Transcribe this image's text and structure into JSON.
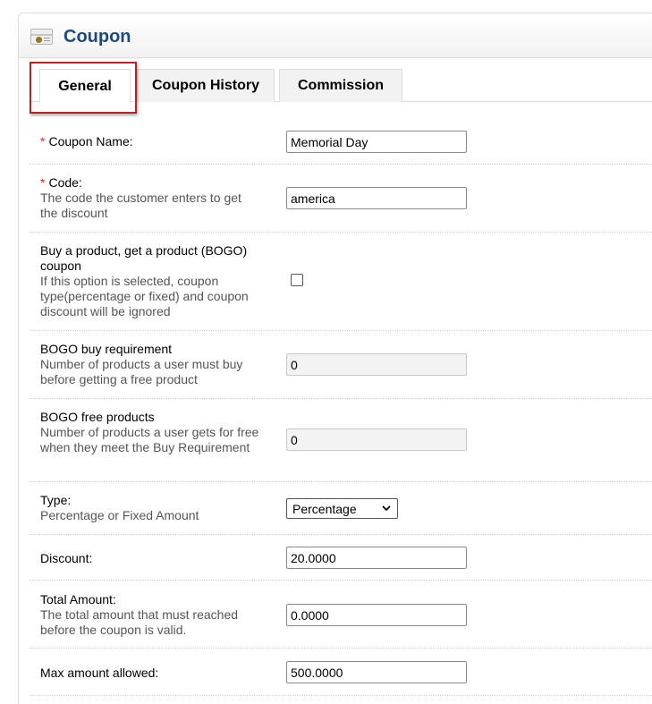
{
  "header": {
    "title": "Coupon",
    "icon": "coupon-card-icon"
  },
  "tabs": [
    {
      "label": "General",
      "active": true
    },
    {
      "label": "Coupon History",
      "active": false
    },
    {
      "label": "Commission",
      "active": false
    }
  ],
  "form": {
    "coupon_name": {
      "label": "Coupon Name:",
      "required": "*",
      "value": "Memorial Day"
    },
    "code": {
      "label": "Code:",
      "required": "*",
      "help": "The code the customer enters to get the discount",
      "value": "america"
    },
    "bogo": {
      "label": "Buy a product, get a product (BOGO) coupon",
      "help": "If this option is selected, coupon type(percentage or fixed) and coupon discount will be ignored",
      "checked": false
    },
    "bogo_buy": {
      "label": "BOGO buy requirement",
      "help": "Number of products a user must buy before getting a free product",
      "value": "0"
    },
    "bogo_free": {
      "label": "BOGO free products",
      "help": "Number of products a user gets for free when they meet the Buy Requirement",
      "value": "0"
    },
    "type": {
      "label": "Type:",
      "help": "Percentage or Fixed Amount",
      "value": "Percentage"
    },
    "discount": {
      "label": "Discount:",
      "value": "20.0000"
    },
    "total_amount": {
      "label": "Total Amount:",
      "help": "The total amount that must reached before the coupon is valid.",
      "value": "0.0000"
    },
    "max_amount": {
      "label": "Max amount allowed:",
      "value": "500.0000"
    }
  },
  "colors": {
    "title": "#1e4a7c",
    "required": "#e02020",
    "highlight": "#b32424"
  }
}
